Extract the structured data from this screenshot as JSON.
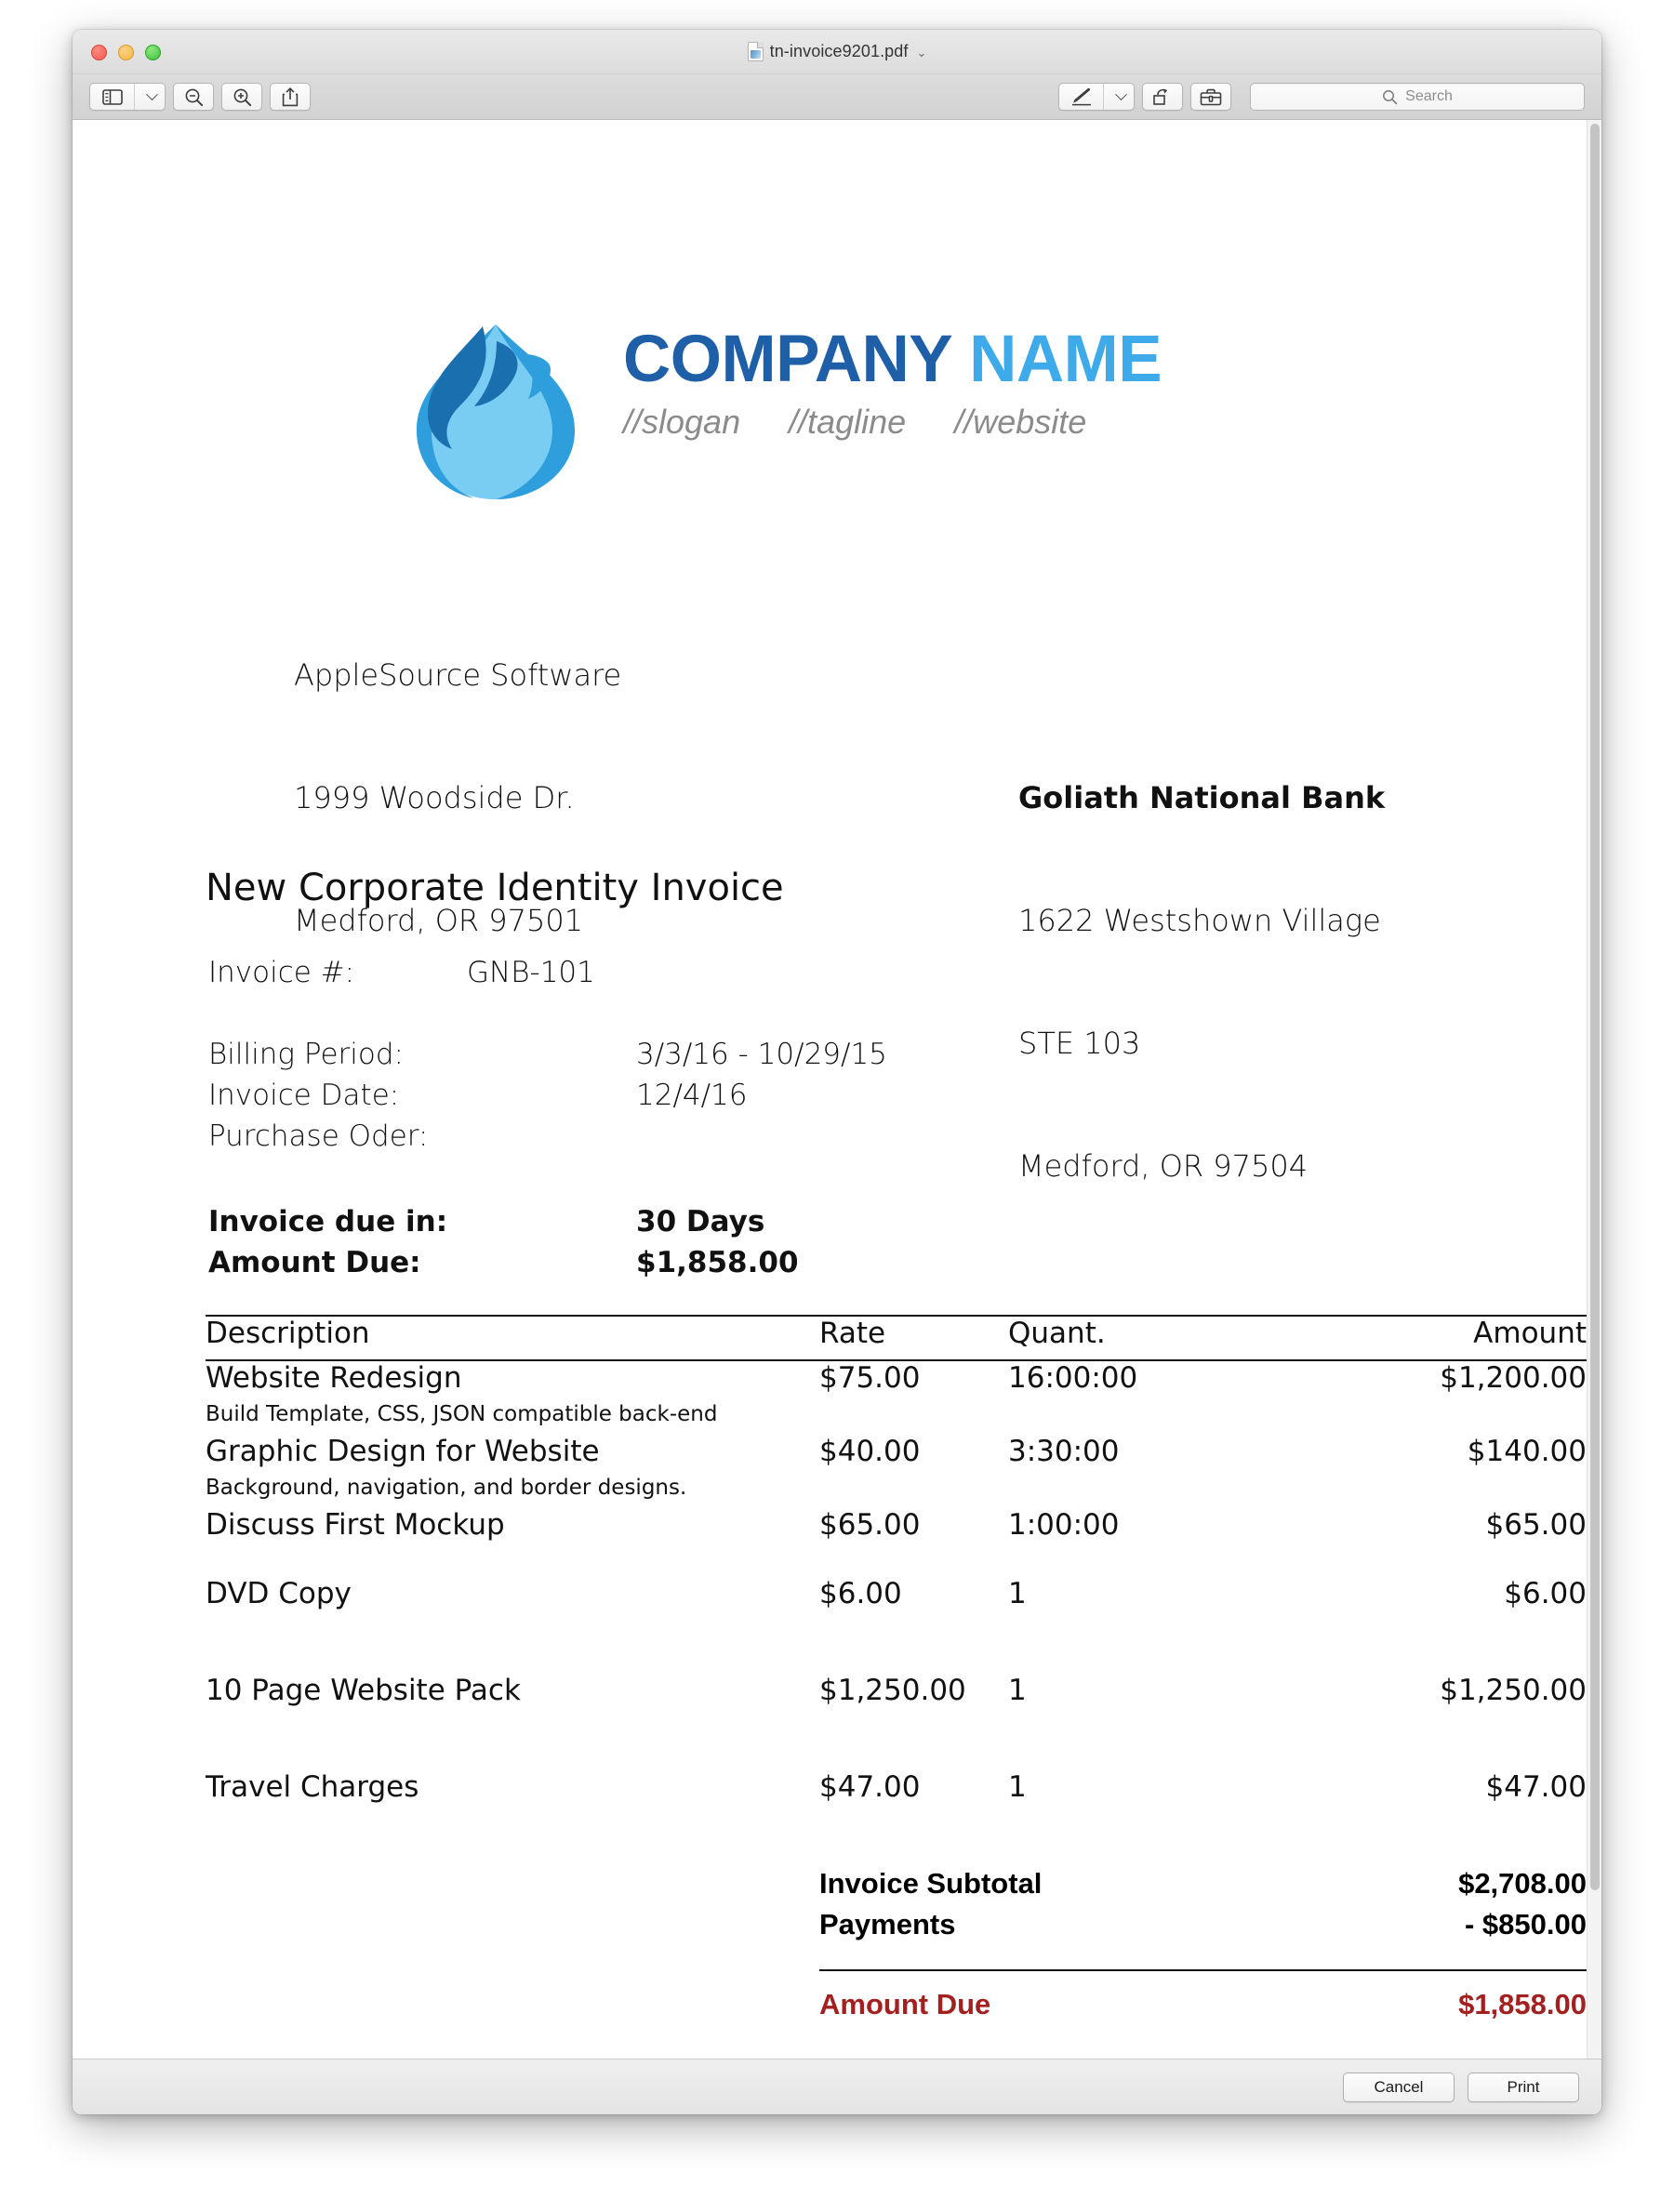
{
  "window": {
    "title": "tn-invoice9201.pdf",
    "title_chevron": "⌄",
    "doc_icon": "pdf-document-icon"
  },
  "traffic_lights": {
    "close": "close-window-button",
    "minimize": "minimize-window-button",
    "maximize": "maximize-window-button"
  },
  "toolbar": {
    "sidebar_toggle": "sidebar-toggle-icon",
    "sidebar_dropdown": "chevron-down-icon",
    "zoom_out": "zoom-out-icon",
    "zoom_in": "zoom-in-icon",
    "share": "share-icon",
    "markup": "markup-pen-icon",
    "markup_dropdown": "chevron-down-icon",
    "rotate": "rotate-icon",
    "toolkit": "toolbox-icon",
    "search": {
      "icon": "search-icon",
      "placeholder": "Search",
      "value": ""
    }
  },
  "bottom_bar": {
    "cancel_label": "Cancel",
    "print_label": "Print"
  },
  "invoice": {
    "logo": {
      "mark": "blue-flame-droplet-logo",
      "name_part1": "COMPANY",
      "name_part2": " NAME",
      "slogan": "//slogan",
      "tagline": "//tagline",
      "website": "//website",
      "color_dark": "#1f5fa8",
      "color_light": "#3eaaea",
      "color_sub": "#8b8b8b"
    },
    "from": {
      "line1": "AppleSource Software",
      "line2": "1999 Woodside Dr.",
      "line3": "Medford, OR 97501"
    },
    "to": {
      "line1": "Goliath National Bank",
      "line2": "1622 Westshown Village",
      "line3": "STE 103",
      "line4": "Medford, OR 97504"
    },
    "title": "New Corporate Identity Invoice",
    "details": {
      "invoice_number_label": "Invoice #:",
      "invoice_number_value": "GNB-101",
      "billing_period_label": "Billing Period:",
      "billing_period_value": "3/3/16 - 10/29/15",
      "invoice_date_label": "Invoice Date:",
      "invoice_date_value": "12/4/16",
      "purchase_order_label": "Purchase Oder:",
      "purchase_order_value": "",
      "due_in_label": "Invoice due in:",
      "due_in_value": "30 Days",
      "amount_due_label": "Amount Due:",
      "amount_due_value": "$1,858.00"
    },
    "table": {
      "headers": {
        "description": "Description",
        "rate": "Rate",
        "quantity": "Quant.",
        "amount": "Amount"
      },
      "rows": [
        {
          "description": "Website Redesign",
          "rate": "$75.00",
          "quantity": "16:00:00",
          "amount": "$1,200.00",
          "note": "Build Template, CSS, JSON compatible back-end"
        },
        {
          "description": "Graphic Design for Website",
          "rate": "$40.00",
          "quantity": "3:30:00",
          "amount": "$140.00",
          "note": "Background, navigation, and border designs."
        },
        {
          "description": "Discuss First Mockup",
          "rate": "$65.00",
          "quantity": "1:00:00",
          "amount": "$65.00",
          "note": ""
        },
        {
          "description": "DVD Copy",
          "rate": "$6.00",
          "quantity": "1",
          "amount": "$6.00",
          "note": ""
        },
        {
          "description": "10 Page Website Pack",
          "rate": "$1,250.00",
          "quantity": "1",
          "amount": "$1,250.00",
          "note": ""
        },
        {
          "description": "Travel Charges",
          "rate": "$47.00",
          "quantity": "1",
          "amount": "$47.00",
          "note": ""
        }
      ],
      "totals": {
        "subtotal_label": "Invoice Subtotal",
        "subtotal_value": "$2,708.00",
        "payments_label": "Payments",
        "payments_value": "- $850.00",
        "amount_due_label": "Amount Due",
        "amount_due_value": "$1,858.00",
        "amount_due_color": "#a32020"
      }
    }
  }
}
